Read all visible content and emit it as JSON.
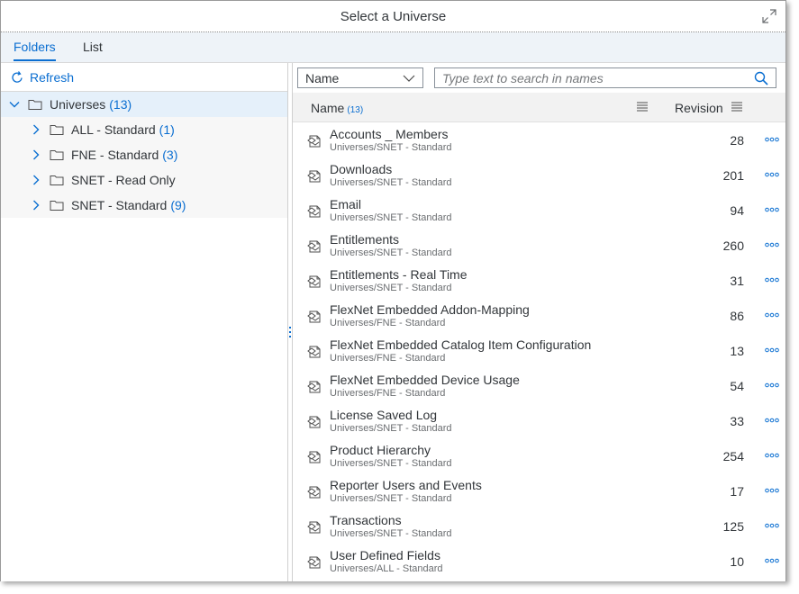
{
  "dialog": {
    "title": "Select a Universe"
  },
  "tabs": [
    {
      "label": "Folders"
    },
    {
      "label": "List"
    }
  ],
  "left": {
    "refresh_label": "Refresh",
    "tree": [
      {
        "label": "Universes",
        "count": "(13)"
      },
      {
        "label": "ALL - Standard",
        "count": "(1)"
      },
      {
        "label": "FNE - Standard",
        "count": "(3)"
      },
      {
        "label": "SNET - Read Only",
        "count": ""
      },
      {
        "label": "SNET - Standard",
        "count": "(9)"
      }
    ]
  },
  "right": {
    "filter_select": "Name",
    "search_placeholder": "Type text to search in names",
    "header": {
      "name": "Name",
      "name_count": "(13)",
      "revision": "Revision"
    },
    "rows": [
      {
        "name": "Accounts _ Members",
        "path": "Universes/SNET - Standard",
        "revision": "28"
      },
      {
        "name": "Downloads",
        "path": "Universes/SNET - Standard",
        "revision": "201"
      },
      {
        "name": "Email",
        "path": "Universes/SNET - Standard",
        "revision": "94"
      },
      {
        "name": "Entitlements",
        "path": "Universes/SNET - Standard",
        "revision": "260"
      },
      {
        "name": "Entitlements - Real Time",
        "path": "Universes/SNET - Standard",
        "revision": "31"
      },
      {
        "name": "FlexNet Embedded Addon-Mapping",
        "path": "Universes/FNE - Standard",
        "revision": "86"
      },
      {
        "name": "FlexNet Embedded Catalog Item Configuration",
        "path": "Universes/FNE - Standard",
        "revision": "13"
      },
      {
        "name": "FlexNet Embedded Device Usage",
        "path": "Universes/FNE - Standard",
        "revision": "54"
      },
      {
        "name": "License Saved Log",
        "path": "Universes/SNET - Standard",
        "revision": "33"
      },
      {
        "name": "Product Hierarchy",
        "path": "Universes/SNET - Standard",
        "revision": "254"
      },
      {
        "name": "Reporter Users and Events",
        "path": "Universes/SNET - Standard",
        "revision": "17"
      },
      {
        "name": "Transactions",
        "path": "Universes/SNET - Standard",
        "revision": "125"
      },
      {
        "name": "User Defined Fields",
        "path": "Universes/ALL - Standard",
        "revision": "10"
      }
    ]
  },
  "colors": {
    "accent": "#0a6ed1",
    "tab_bar": "#eef3f8",
    "header_bg": "#f2f2f2",
    "selected_row": "#e5f0fa"
  }
}
